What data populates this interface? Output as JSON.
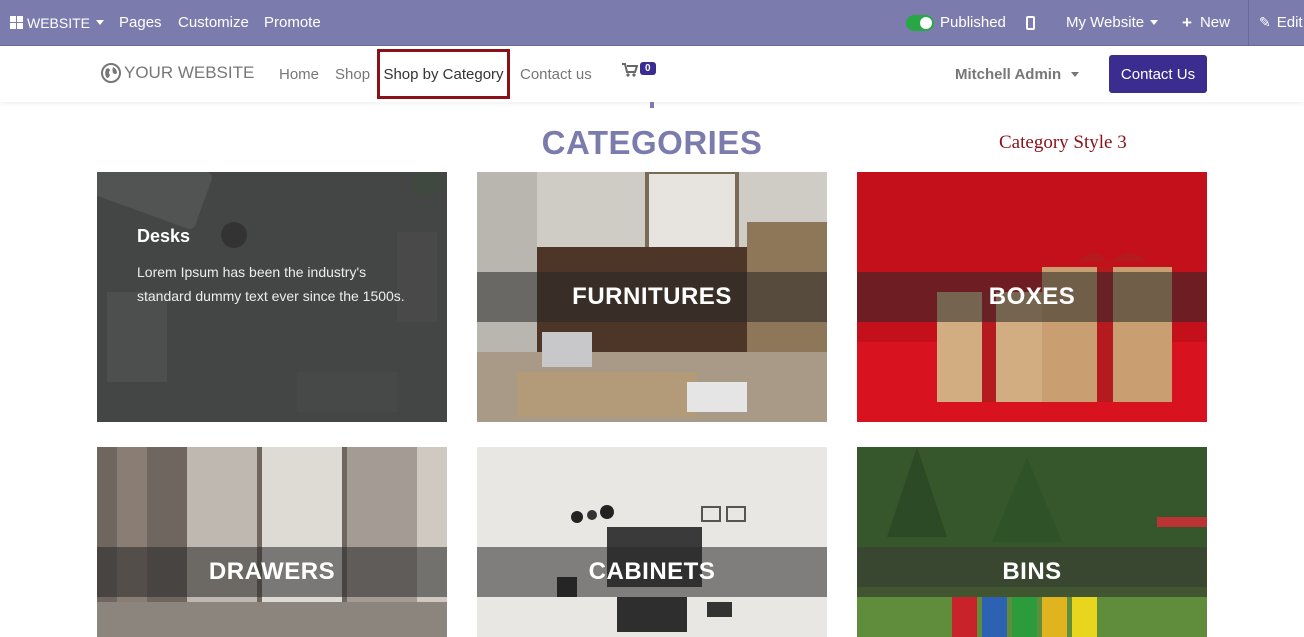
{
  "admin_bar": {
    "website_menu": "WEBSITE",
    "pages": "Pages",
    "customize": "Customize",
    "promote": "Promote",
    "published": "Published",
    "my_website": "My Website",
    "new": "New",
    "edit": "Edit"
  },
  "header": {
    "logo_text": "YOUR WEBSITE",
    "nav": {
      "home": "Home",
      "shop": "Shop",
      "shop_by_category": "Shop by Category",
      "contact_us": "Contact us"
    },
    "cart_count": "0",
    "user": "Mitchell Admin",
    "contact_button": "Contact Us"
  },
  "section": {
    "title": "CATEGORIES",
    "style_label": "Category Style 3"
  },
  "categories": [
    {
      "name": "Desks",
      "description": "Lorem Ipsum has been the industry's standard dummy text ever since the 1500s."
    },
    {
      "name": "FURNITURES"
    },
    {
      "name": "BOXES"
    },
    {
      "name": "DRAWERS"
    },
    {
      "name": "CABINETS"
    },
    {
      "name": "BINS"
    }
  ],
  "colors": {
    "admin_bar": "#7c7bad",
    "brand": "#3b2d8f",
    "highlight_border": "#8b1119",
    "title": "#7c7bad"
  }
}
